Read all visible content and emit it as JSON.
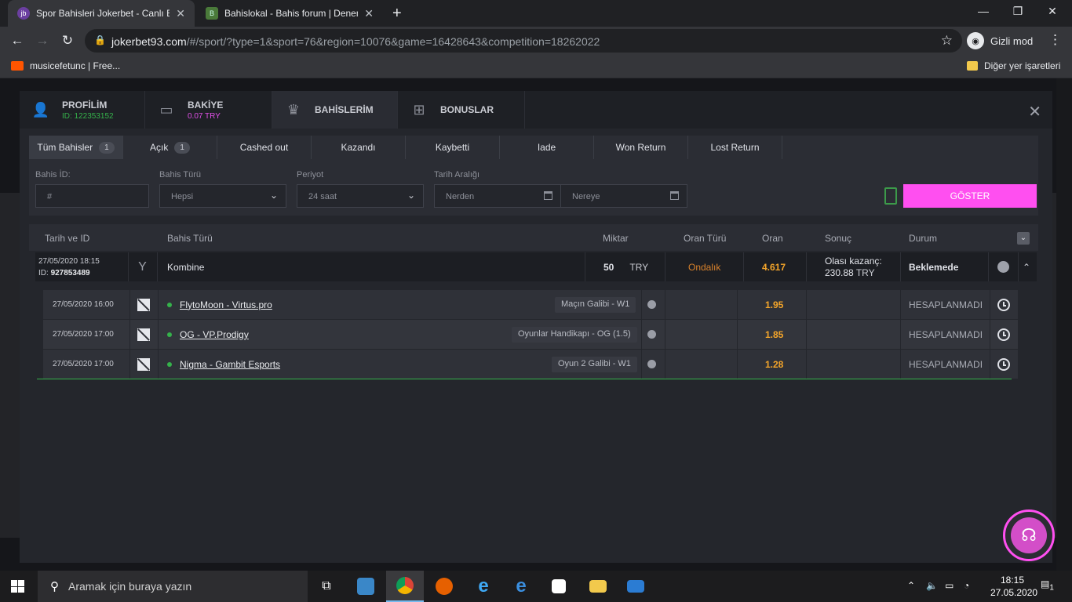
{
  "browser": {
    "tabs": [
      {
        "title": "Spor Bahisleri Jokerbet - Canlı Ba",
        "favicon": "jb",
        "active": true
      },
      {
        "title": "Bahislokal - Bahis forum | Deneme",
        "favicon": "B",
        "active": false
      }
    ],
    "new_tab": "+",
    "url_host": "jokerbet93.com",
    "url_path": "/#/sport/?type=1&sport=76&region=10076&game=16428643&competition=18262022",
    "incognito_label": "Gizli mod",
    "bookmarks": [
      {
        "label": "musicefetunc | Free..."
      }
    ],
    "other_bookmarks": "Diğer yer işaretleri"
  },
  "modal": {
    "tabs": [
      {
        "label": "PROFİLİM",
        "sub": "ID: 122353152"
      },
      {
        "label": "BAKİYE",
        "sub": "0.07 TRY"
      },
      {
        "label": "BAHİSLERİM",
        "sub": ""
      },
      {
        "label": "BONUSLAR",
        "sub": ""
      }
    ],
    "close": "✕",
    "filter_tabs": [
      {
        "label": "Tüm Bahisler",
        "count": "1"
      },
      {
        "label": "Açık",
        "count": "1"
      },
      {
        "label": "Cashed out",
        "count": ""
      },
      {
        "label": "Kazandı",
        "count": ""
      },
      {
        "label": "Kaybetti",
        "count": ""
      },
      {
        "label": "Iade",
        "count": ""
      },
      {
        "label": "Won Return",
        "count": ""
      },
      {
        "label": "Lost Return",
        "count": ""
      }
    ],
    "filters": {
      "bet_id_label": "Bahis İD:",
      "bet_id_placeholder": "#",
      "bet_type_label": "Bahis Türü",
      "bet_type_value": "Hepsi",
      "period_label": "Periyot",
      "period_value": "24 saat",
      "date_range_label": "Tarih Aralığı",
      "date_from_placeholder": "Nerden",
      "date_to_placeholder": "Nereye",
      "show_button": "GÖSTER"
    },
    "table": {
      "headers": {
        "date_id": "Tarih ve ID",
        "bet_type": "Bahis Türü",
        "amount": "Miktar",
        "odds_type": "Oran Türü",
        "odds": "Oran",
        "result": "Sonuç",
        "status": "Durum"
      },
      "bet": {
        "datetime": "27/05/2020 18:15",
        "id_label": "ID:",
        "id": "927853489",
        "type": "Kombine",
        "amount": "50",
        "currency": "TRY",
        "odds_type": "Ondalık",
        "odds": "4.617",
        "possible_win_label": "Olası kazanç:",
        "possible_win": "230.88",
        "possible_win_currency": "TRY",
        "status": "Beklemede"
      },
      "selections": [
        {
          "datetime": "27/05/2020 16:00",
          "match": "FlytoMoon - Virtus.pro",
          "market": "Maçın Galibi - W1",
          "odds": "1.95",
          "status": "HESAPLANMADI"
        },
        {
          "datetime": "27/05/2020 17:00",
          "match": "OG - VP.Prodigy",
          "market": "Oyunlar Handikapı - OG (1.5)",
          "odds": "1.85",
          "status": "HESAPLANMADI"
        },
        {
          "datetime": "27/05/2020 17:00",
          "match": "Nigma - Gambit Esports",
          "market": "Oyun 2 Galibi - W1",
          "odds": "1.28",
          "status": "HESAPLANMADI"
        }
      ]
    }
  },
  "colors": {
    "accent_pink": "#ff4ff0",
    "odds_orange": "#f4a52a",
    "id_green": "#35b24b",
    "balance_pink": "#e04fe6"
  },
  "taskbar": {
    "search_placeholder": "Aramak için buraya yazın",
    "time": "18:15",
    "date": "27.05.2020",
    "notification_count": "1"
  }
}
